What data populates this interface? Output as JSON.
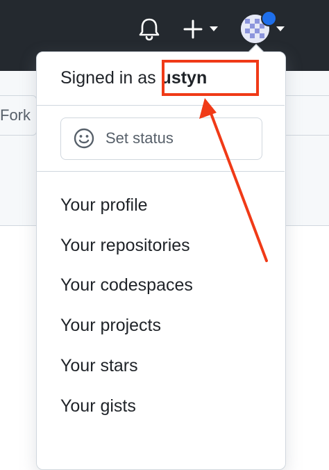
{
  "header": {
    "icons": [
      "bell-icon",
      "plus-icon",
      "chevron-down-icon",
      "avatar",
      "notification-dot"
    ]
  },
  "page": {
    "fork_label": "Fork"
  },
  "dropdown": {
    "signed_in_prefix": "Signed in as ",
    "username": "ustyn",
    "set_status_label": "Set status",
    "items": [
      {
        "label": "Your profile"
      },
      {
        "label": "Your repositories"
      },
      {
        "label": "Your codespaces"
      },
      {
        "label": "Your projects"
      },
      {
        "label": "Your stars"
      },
      {
        "label": "Your gists"
      }
    ]
  },
  "colors": {
    "header_bg": "#24292f",
    "accent_blue": "#1f6feb",
    "annotation_red": "#f03a17"
  }
}
